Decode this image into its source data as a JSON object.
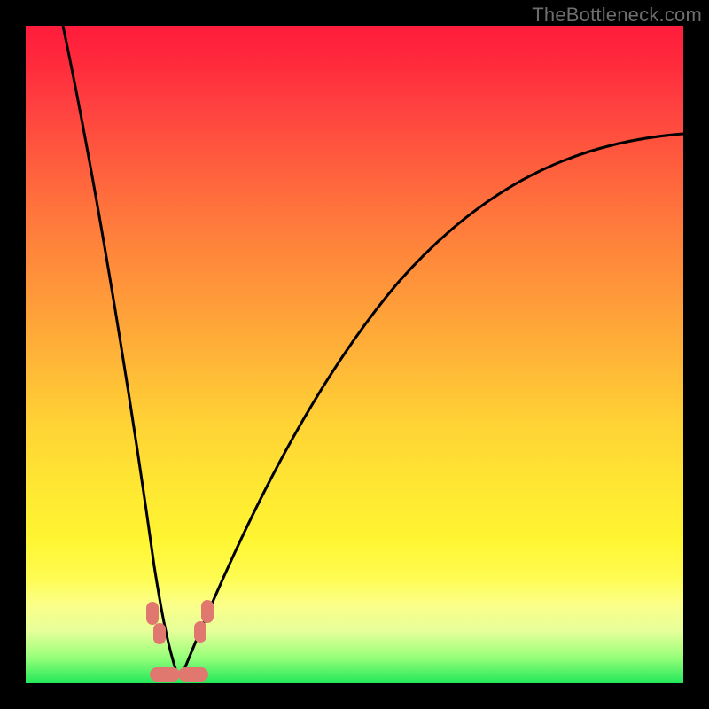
{
  "watermark": "TheBottleneck.com",
  "colors": {
    "frame_bg": "#000000",
    "gradient_top": "#ff1c3c",
    "gradient_bottom": "#22e85a",
    "curve_stroke": "#000000",
    "marker_fill": "#e07870"
  },
  "chart_data": {
    "type": "line",
    "title": "",
    "xlabel": "",
    "ylabel": "",
    "xlim": [
      0,
      100
    ],
    "ylim": [
      0,
      100
    ],
    "annotations": [],
    "series": [
      {
        "name": "left-branch",
        "x": [
          0,
          2,
          4,
          6,
          8,
          10,
          12,
          14,
          16,
          18,
          19,
          20,
          21,
          22
        ],
        "y": [
          100,
          91,
          82,
          73,
          64,
          55,
          46,
          37,
          28,
          19,
          14.5,
          10,
          5,
          1
        ]
      },
      {
        "name": "right-branch",
        "x": [
          22,
          24,
          26,
          28,
          30,
          34,
          38,
          42,
          46,
          50,
          55,
          60,
          65,
          70,
          75,
          80,
          85,
          90,
          95,
          100
        ],
        "y": [
          1,
          7,
          13,
          19,
          24,
          33,
          41,
          48,
          53,
          58,
          63,
          67,
          70.5,
          73.5,
          76,
          78,
          79.7,
          81.2,
          82.5,
          83.5
        ]
      }
    ],
    "markers": [
      {
        "name": "marker-left-top",
        "x": 19.0,
        "y": 10.0
      },
      {
        "name": "marker-left-bottom",
        "x": 19.8,
        "y": 6.2
      },
      {
        "name": "marker-right-top",
        "x": 27.3,
        "y": 10.0
      },
      {
        "name": "marker-right-bottom",
        "x": 26.5,
        "y": 6.2
      },
      {
        "name": "marker-floor-left",
        "x": 20.5,
        "y": 0.8
      },
      {
        "name": "marker-floor-right",
        "x": 25.5,
        "y": 0.8
      }
    ]
  }
}
